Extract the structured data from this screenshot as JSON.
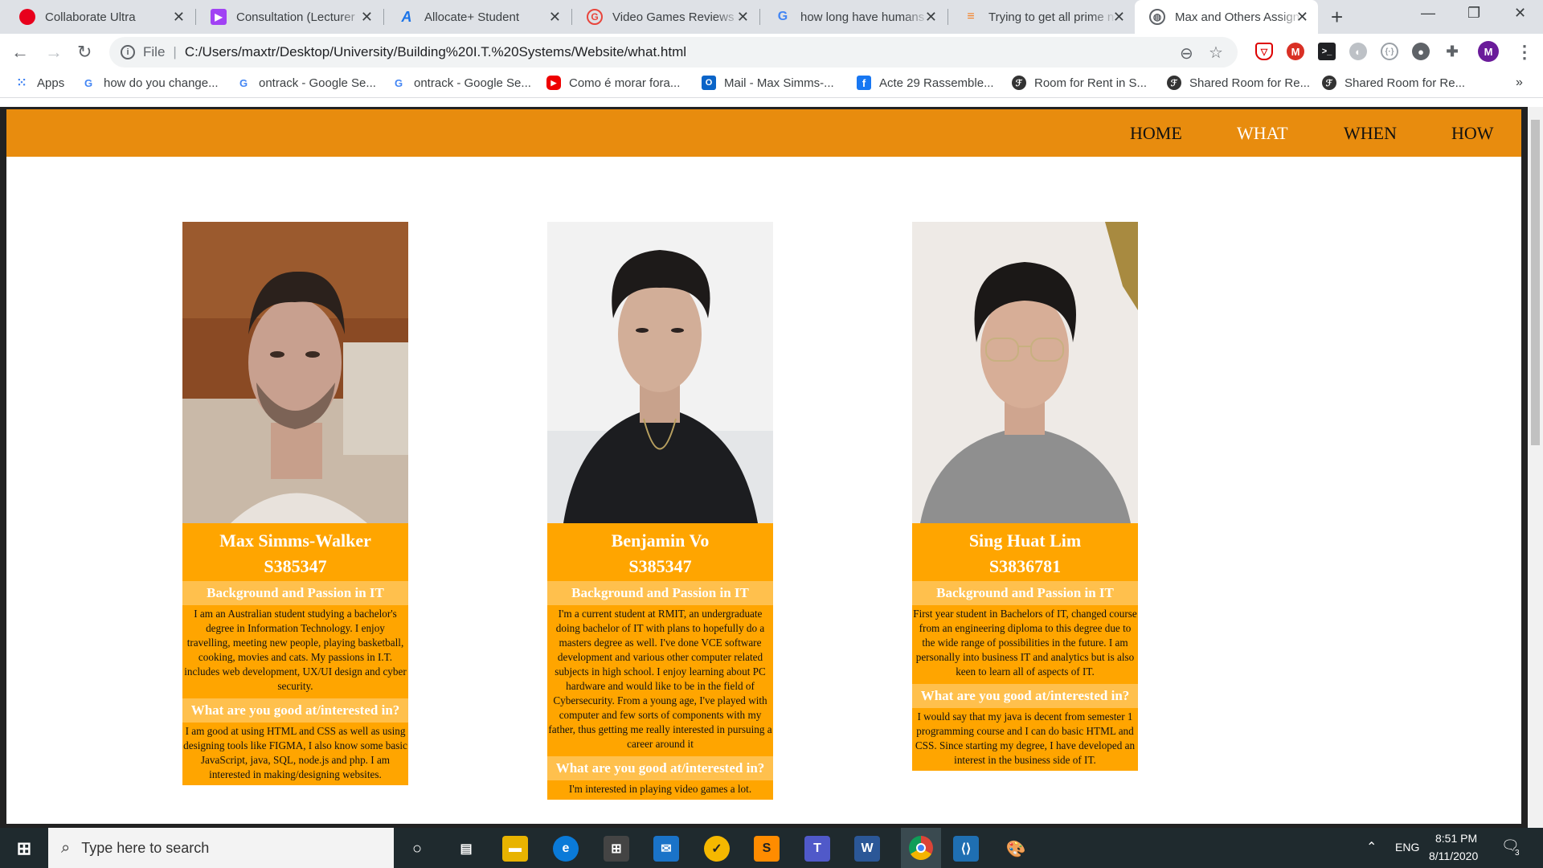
{
  "browser": {
    "tabs": [
      {
        "title": "Collaborate Ultra",
        "color": "#e8001c",
        "glyph": ""
      },
      {
        "title": "Consultation (Lecturer",
        "color": "#a142f4",
        "glyph": "▶"
      },
      {
        "title": "Allocate+ Student",
        "color": "#1a73e8",
        "glyph": "A"
      },
      {
        "title": "Video Games Reviews &",
        "color": "#e8453c",
        "glyph": "G"
      },
      {
        "title": "how long have humans",
        "color": "#4285f4",
        "glyph": "G"
      },
      {
        "title": "Trying to get all prime n",
        "color": "#f48024",
        "glyph": "≡"
      },
      {
        "title": "Max and Others Assign",
        "color": "#5f6368",
        "glyph": "◍"
      }
    ],
    "address": {
      "scheme_label": "File",
      "url": "C:/Users/maxtr/Desktop/University/Building%20I.T.%20Systems/Website/what.html"
    },
    "profile_initial": "M",
    "bookmarks": [
      {
        "label": "Apps",
        "icon": "apps-icon"
      },
      {
        "label": "how do you change...",
        "icon": "google-icon"
      },
      {
        "label": "ontrack - Google Se...",
        "icon": "google-icon"
      },
      {
        "label": "ontrack - Google Se...",
        "icon": "google-icon"
      },
      {
        "label": "Como é morar fora...",
        "icon": "youtube-icon"
      },
      {
        "label": "Mail - Max Simms-...",
        "icon": "outlook-icon"
      },
      {
        "label": "Acte 29 Rassemble...",
        "icon": "facebook-icon"
      },
      {
        "label": "Room for Rent in S...",
        "icon": "flatmates-icon"
      },
      {
        "label": "Shared Room for Re...",
        "icon": "flatmates-icon"
      },
      {
        "label": "Shared Room for Re...",
        "icon": "flatmates-icon"
      }
    ],
    "more_bookmarks": "»"
  },
  "site": {
    "nav": [
      "HOME",
      "WHAT",
      "WHEN",
      "HOW"
    ],
    "accent": "#e88c0e",
    "card_bg": "#ffa500",
    "members": [
      {
        "name": "Max Simms-Walker",
        "id": "S385347",
        "bg_heading": "Background and Passion in IT",
        "bg_text": "I am an Australian student studying a bachelor's degree in Information Technology. I enjoy travelling, meeting new people, playing basketball, cooking, movies and cats. My passions in I.T. includes web development, UX/UI design and cyber security.",
        "good_heading": "What are you good at/interested in?",
        "good_text": "I am good at using HTML and CSS as well as using designing tools like FIGMA, I also know some basic JavaScript, java, SQL, node.js and php. I am interested in making/designing websites."
      },
      {
        "name": "Benjamin Vo",
        "id": "S385347",
        "bg_heading": "Background and Passion in IT",
        "bg_text": "I'm a current student at RMIT, an undergraduate doing bachelor of IT with plans to hopefully do a masters degree as well. I've done VCE software development and various other computer related subjects in high school. I enjoy learning about PC hardware and would like to be in the field of Cybersecurity. From a young age, I've played with computer and few sorts of components with my father, thus getting me really interested in pursuing a career around it",
        "good_heading": "What are you good at/interested in?",
        "good_text": "I'm interested in playing video games a lot."
      },
      {
        "name": "Sing Huat Lim",
        "id": "S3836781",
        "bg_heading": "Background and Passion in IT",
        "bg_text": "First year student in Bachelors of IT, changed course from an engineering diploma to this degree due to the wide range of possibilities in the future. I am personally into business IT and analytics but is also keen to learn all of aspects of IT.",
        "good_heading": "What are you good at/interested in?",
        "good_text": "I would say that my java is decent from semester 1 programming course and I can do basic HTML and CSS. Since starting my degree, I have developed an interest in the business side of IT."
      }
    ]
  },
  "taskbar": {
    "search_placeholder": "Type here to search",
    "language": "ENG",
    "time": "8:51 PM",
    "date": "8/11/2020",
    "notification_count": "3"
  }
}
